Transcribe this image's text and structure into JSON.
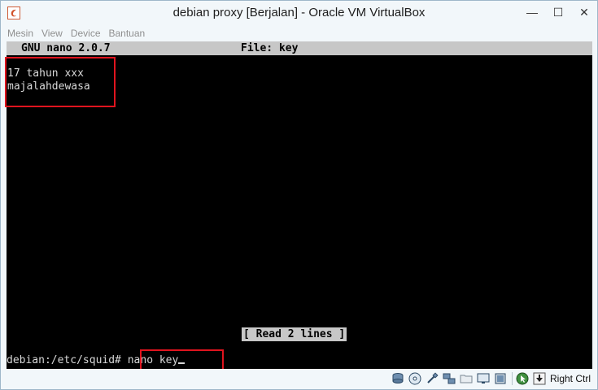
{
  "window": {
    "title": "debian proxy [Berjalan] - Oracle VM VirtualBox",
    "controls": {
      "minimize": "—",
      "maximize": "☐",
      "close": "✕"
    }
  },
  "menubar": {
    "items": [
      {
        "label": "Mesin"
      },
      {
        "label": "View"
      },
      {
        "label": "Device"
      },
      {
        "label": "Bantuan"
      }
    ]
  },
  "terminal": {
    "nano_version": "GNU nano 2.0.7",
    "file_title": "File: key",
    "lines": [
      "17 tahun xxx",
      "majalahdewasa"
    ],
    "status_message": "[ Read 2 lines ]",
    "prompt": "debian:/etc/squid#",
    "command": "nano key"
  },
  "statusbar": {
    "icons": [
      "hard-disk-icon",
      "optical-drive-icon",
      "usb-icon",
      "network-icon",
      "shared-folders-icon",
      "display-icon",
      "capture-icon",
      "mouse-integration-icon"
    ],
    "host_key": "Right Ctrl"
  },
  "colors": {
    "highlight": "#e0141e",
    "terminal_bg": "#000000",
    "nano_bar": "#c7c7c7"
  }
}
